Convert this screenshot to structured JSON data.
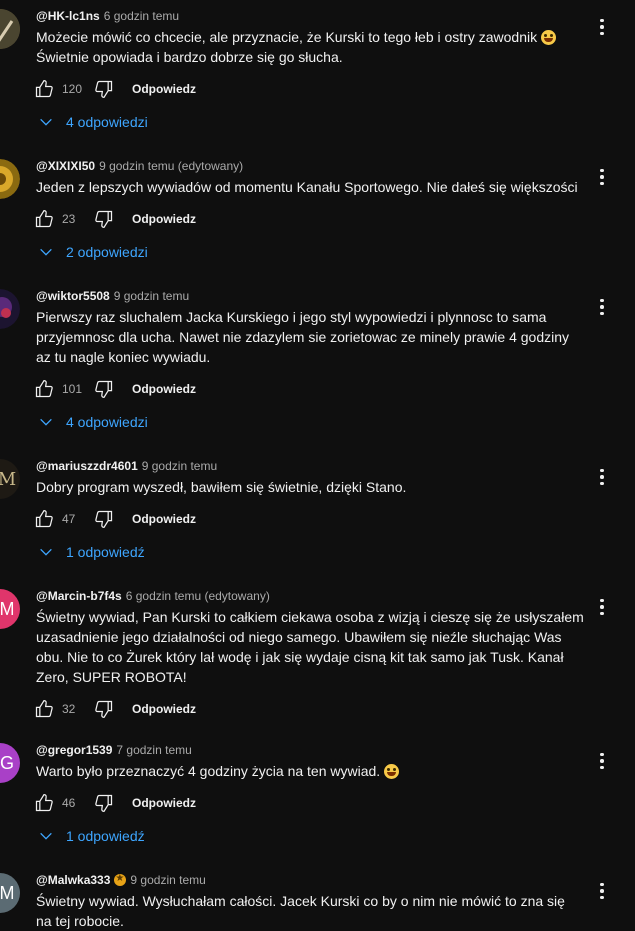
{
  "ui": {
    "reply_label": "Odpowiedz"
  },
  "comments": [
    {
      "author": "@HK-lc1ns",
      "time": "6 godzin temu",
      "lines": [
        "Możecie mówić co chcecie, ale przyznacie, że Kurski to tego łeb i ostry zawodnik",
        "Świetnie opowiada  i bardzo dobrze się go słucha."
      ],
      "emoji": "grinning-face-emoji",
      "likes": "120",
      "replies": "4 odpowiedzi",
      "avatar": {
        "letter": "",
        "color": "#7a6a3a"
      }
    },
    {
      "author": "@XIXIXI50",
      "time": "9 godzin temu (edytowany)",
      "lines": [
        "Jeden z lepszych wywiadów od momentu Kanału Sportowego. Nie dałeś się większości"
      ],
      "likes": "23",
      "replies": "2 odpowiedzi",
      "avatar": {
        "letter": "",
        "color": "#b58a1a"
      }
    },
    {
      "author": "@wiktor5508",
      "time": "9 godzin temu",
      "lines": [
        "Pierwszy raz sluchalem Jacka Kurskiego i jego styl wypowiedzi i plynnosc to sama",
        "przyjemnosc dla ucha. Nawet nie zdazylem sie zorietowac ze minely prawie 4 godziny",
        "az tu nagle koniec wywiadu."
      ],
      "likes": "101",
      "replies": "4 odpowiedzi",
      "avatar": {
        "letter": "",
        "color": "#3a2a6a"
      }
    },
    {
      "author": "@mariuszzdr4601",
      "time": "9 godzin temu",
      "lines": [
        "Dobry program wyszedł, bawiłem się świetnie, dzięki Stano."
      ],
      "likes": "47",
      "replies": "1 odpowiedź",
      "avatar": {
        "letter": "M",
        "color": "#1e1a14"
      }
    },
    {
      "author": "@Marcin-b7f4s",
      "time": "6 godzin temu (edytowany)",
      "lines": [
        "Świetny wywiad, Pan Kurski to całkiem ciekawa osoba z wizją i cieszę się że usłyszałem",
        "uzasadnienie jego działalności od niego samego. Ubawiłem się nieźle słuchając Was",
        "obu. Nie to co Żurek który lał wodę i jak się wydaje cisną kit tak samo jak Tusk. Kanał",
        "Zero, SUPER ROBOTA!"
      ],
      "likes": "32",
      "replies": "",
      "avatar": {
        "letter": "M",
        "color": "#e0356b"
      }
    },
    {
      "author": "@gregor1539",
      "time": "7 godzin temu",
      "lines": [
        "Warto było przeznaczyć 4 godziny życia na ten wywiad."
      ],
      "emoji": "laughing-face-emoji",
      "likes": "46",
      "replies": "1 odpowiedź",
      "avatar": {
        "letter": "G",
        "color": "#a940c7"
      }
    },
    {
      "author": "@Malwka333",
      "time": "9 godzin temu",
      "lines": [
        "Świetny wywiad. Wysłuchałam całości. Jacek Kurski co by o nim nie mówić to zna się",
        "na tej robocie."
      ],
      "likes": "",
      "replies": "",
      "avatar": {
        "letter": "M",
        "color": "#5b6b73"
      }
    }
  ]
}
